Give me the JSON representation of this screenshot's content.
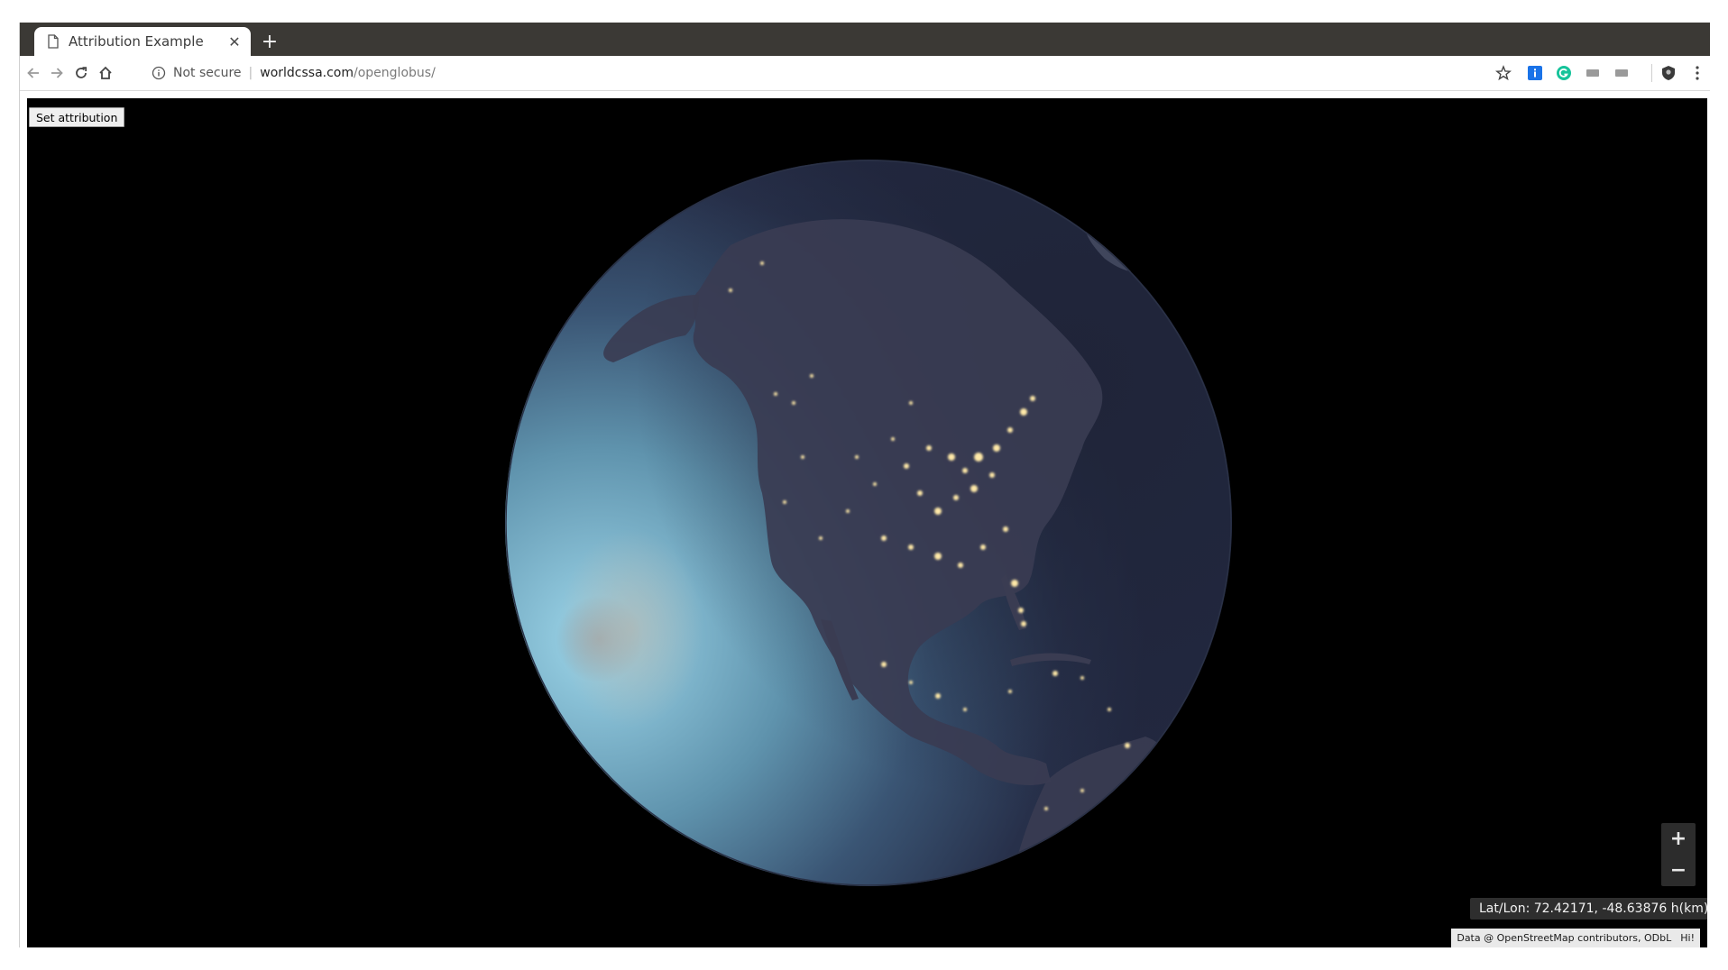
{
  "tab": {
    "title": "Attribution Example",
    "icon": "document-icon",
    "close_icon": "close-icon",
    "new_tab_label": "+"
  },
  "toolbar": {
    "back_icon": "arrow-left-icon",
    "forward_icon": "arrow-right-icon",
    "reload_icon": "reload-icon",
    "home_icon": "home-icon",
    "security_label": "Not secure",
    "url_host": "worldcssa.com",
    "url_path": "/openglobus/",
    "extensions": [
      "star-icon",
      "info-extension-icon",
      "grammarly-icon",
      "extension-icon",
      "extension-icon",
      "profile-icon",
      "menu-icon"
    ]
  },
  "page": {
    "set_attribution_label": "Set attribution",
    "zoom_in_label": "+",
    "zoom_out_label": "−",
    "coords_text": "Lat/Lon: 72.42171, -48.63876 h(km): -",
    "attribution_text": "Data @ OpenStreetMap contributors, ODbL",
    "attribution_hi": "Hi!"
  },
  "colors": {
    "tabstrip": "#3b3935",
    "globe_day": "#8cc6dc",
    "globe_night": "#242a40",
    "city_lights": "#ffe9a8"
  }
}
